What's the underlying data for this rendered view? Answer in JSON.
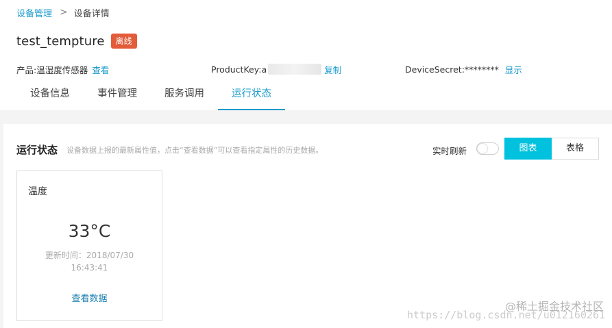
{
  "breadcrumb": {
    "parent": "设备管理",
    "separator": ">",
    "current": "设备详情"
  },
  "device": {
    "name": "test_tempture",
    "status": "离线",
    "status_color": "#e35c3a"
  },
  "meta": {
    "product_label": "产品:",
    "product_value": "温湿度传感器",
    "product_link": "查看",
    "productkey_label": "ProductKey:",
    "productkey_value": "a",
    "productkey_link": "复制",
    "secret_label": "DeviceSecret:",
    "secret_value": "********",
    "secret_link": "显示"
  },
  "tabs": [
    {
      "label": "设备信息",
      "active": false
    },
    {
      "label": "事件管理",
      "active": false
    },
    {
      "label": "服务调用",
      "active": false
    },
    {
      "label": "运行状态",
      "active": true
    }
  ],
  "section": {
    "title": "运行状态",
    "description": "设备数据上报的最新属性值，点击“查看数据”可以查看指定属性的历史数据。",
    "refresh_label": "实时刷新",
    "refresh_on": false,
    "view_chart": "图表",
    "view_table": "表格",
    "active_view": "图表"
  },
  "property_card": {
    "name": "温度",
    "value": "33°C",
    "updated_label": "更新时间：",
    "updated_date": "2018/07/30",
    "updated_time": "16:43:41",
    "link": "查看数据"
  },
  "watermark": {
    "brand": "@稀土掘金技术社区",
    "url": "https://blog.csdn.net/u012160261"
  },
  "colors": {
    "accent": "#1a9bcd",
    "button_active": "#00c1de",
    "badge": "#e35c3a"
  },
  "icons": {
    "breadcrumb_separator": "chevron-right-icon"
  }
}
